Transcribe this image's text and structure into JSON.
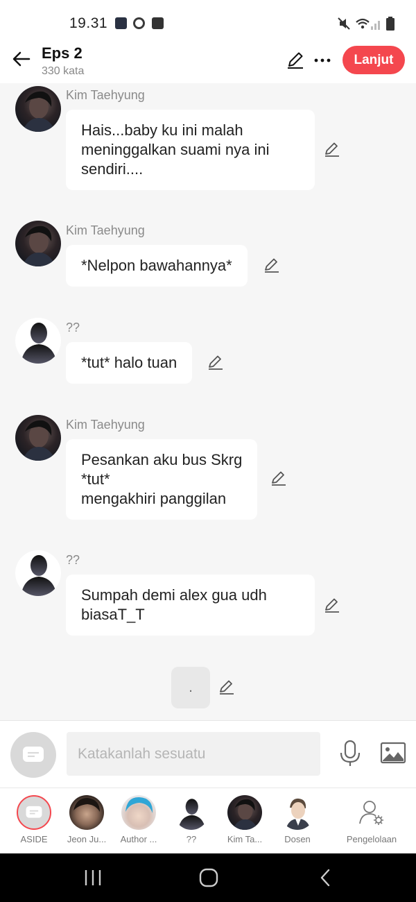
{
  "status": {
    "time": "19.31"
  },
  "header": {
    "title": "Eps 2",
    "subtitle": "330 kata",
    "next_label": "Lanjut"
  },
  "messages": [
    {
      "name": "Kim Taehyung",
      "text": "Hais...baby ku ini malah meninggalkan suami nya ini sendiri....",
      "avatar": "kim-taehyung"
    },
    {
      "name": "Kim Taehyung",
      "text": "*Nelpon bawahannya*",
      "avatar": "kim-taehyung"
    },
    {
      "name": "??",
      "text": "*tut* halo tuan",
      "avatar": "silhouette"
    },
    {
      "name": "Kim Taehyung",
      "text": "Pesankan aku bus Skrg\n*tut*\nmengakhiri panggilan",
      "avatar": "kim-taehyung"
    },
    {
      "name": "??",
      "text": "Sumpah demi alex gua udh biasaT_T",
      "avatar": "silhouette"
    },
    {
      "name": "",
      "text": ".",
      "avatar": ""
    }
  ],
  "input": {
    "placeholder": "Katakanlah sesuatu"
  },
  "characters": [
    {
      "label": "ASIDE"
    },
    {
      "label": "Jeon Ju..."
    },
    {
      "label": "Author ..."
    },
    {
      "label": "??"
    },
    {
      "label": "Kim Ta..."
    },
    {
      "label": "Dosen"
    },
    {
      "label": "Pengelolaan"
    }
  ],
  "colors": {
    "accent": "#f4474e",
    "background": "#f6f6f6",
    "bubble": "#ffffff"
  },
  "icons": [
    "back-arrow-icon",
    "pencil-icon",
    "more-icon",
    "mic-icon",
    "image-icon",
    "aside-icon",
    "manage-icon"
  ]
}
